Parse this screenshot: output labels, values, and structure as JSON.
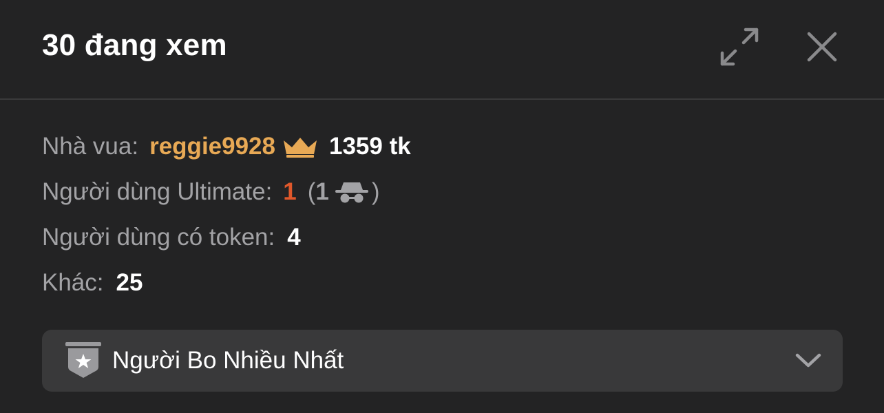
{
  "header": {
    "viewer_count": "30",
    "viewers_label": "đang xem"
  },
  "stats": {
    "king_label": "Nhà vua:",
    "king_username": "reggie9928",
    "king_tokens": "1359 tk",
    "ultimate_label": "Người dùng Ultimate:",
    "ultimate_count": "1",
    "ultimate_paren_open": "(",
    "ultimate_anon_count": "1",
    "ultimate_paren_close": ")",
    "token_users_label": "Người dùng có token:",
    "token_users_count": "4",
    "others_label": "Khác:",
    "others_count": "25"
  },
  "dropdown": {
    "label": "Người Bo Nhiều Nhất"
  },
  "icons": {
    "expand": "expand-icon",
    "close": "close-icon",
    "crown": "crown-icon",
    "incognito": "incognito-icon",
    "badge": "star-badge-icon",
    "chevron": "chevron-down-icon"
  },
  "colors": {
    "background": "#232324",
    "king_name": "#e8a955",
    "ultimate_count": "#e0582b",
    "muted_text": "#a3a3a6",
    "dropdown_bg": "#39393a"
  }
}
